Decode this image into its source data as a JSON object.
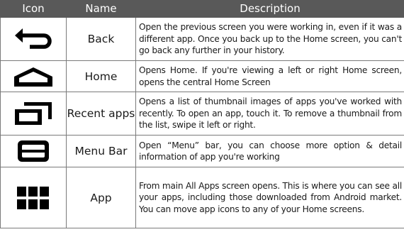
{
  "table": {
    "headers": {
      "icon": "Icon",
      "name": "Name",
      "description": "Description"
    },
    "rows": [
      {
        "icon": "back-arrow-icon",
        "name": "Back",
        "description": "Open the previous screen you were working in, even if it was a different app. Once you back up to the Home screen, you can't go back any further in your history."
      },
      {
        "icon": "home-icon",
        "name": "Home",
        "description": "Opens Home. If you're viewing a left or right Home screen, opens the central Home Screen"
      },
      {
        "icon": "recent-apps-icon",
        "name": "Recent apps",
        "description": "Opens a list of thumbnail images of apps you've worked with recently. To open an app, touch it. To remove a thumbnail from the list, swipe it left or right."
      },
      {
        "icon": "menu-bar-icon",
        "name": "Menu Bar",
        "description": "Open “Menu” bar, you can choose more option & detail information of app you're working"
      },
      {
        "icon": "app-grid-icon",
        "name": "App",
        "description": "From main All Apps screen opens. This is where you can see all your apps, including those downloaded from Android market. You can move app icons to any of your Home screens."
      }
    ]
  },
  "colors": {
    "header_bg": "#595959",
    "header_text": "#ffffff",
    "icon_color": "#000000",
    "border": "#7a7a7a"
  }
}
